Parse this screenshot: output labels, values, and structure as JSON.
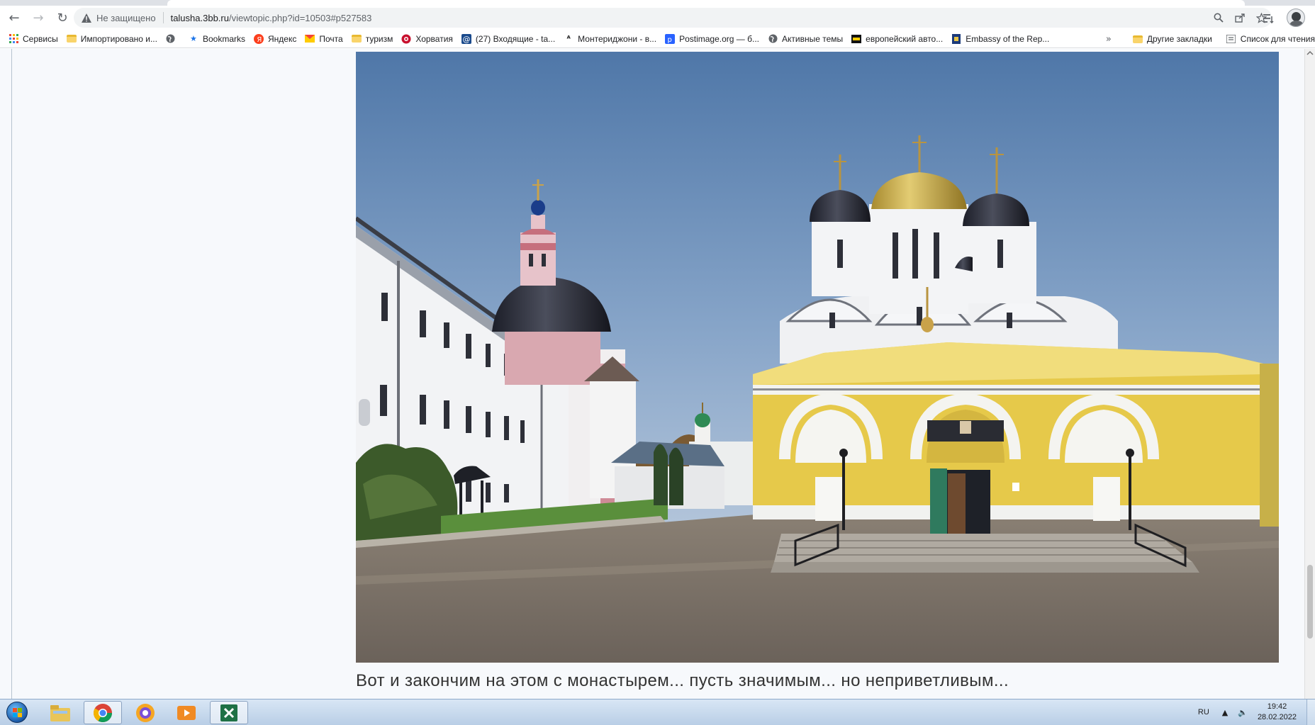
{
  "browser": {
    "security_text": "Не защищено",
    "url_host": "talusha.3bb.ru",
    "url_path": "/viewtopic.php?id=10503#p527583",
    "nav": {
      "back": "←",
      "forward": "→",
      "reload": "↻"
    },
    "omnibox_icons": [
      "zoom-icon",
      "share-icon",
      "star-icon"
    ],
    "toolbar_icons": [
      "reading-list-icon"
    ]
  },
  "bookmarks": {
    "items": [
      {
        "label": "Сервисы",
        "icon": "apps-grid-icon"
      },
      {
        "label": "Импортировано и...",
        "icon": "folder-icon"
      },
      {
        "label": "",
        "icon": "globe-icon"
      },
      {
        "label": "Bookmarks",
        "icon": "star-icon"
      },
      {
        "label": "Яндекс",
        "icon": "yandex-icon"
      },
      {
        "label": "Почта",
        "icon": "mail-icon"
      },
      {
        "label": "туризм",
        "icon": "folder-icon"
      },
      {
        "label": "Хорватия",
        "icon": "croatia-icon"
      },
      {
        "label": "(27) Входящие - ta...",
        "icon": "mail-at-icon"
      },
      {
        "label": "Монтериджони - в...",
        "icon": "tripadvisor-icon"
      },
      {
        "label": "Postimage.org — б...",
        "icon": "postimage-icon"
      },
      {
        "label": "Активные темы",
        "icon": "globe-icon"
      },
      {
        "label": "европейский авто...",
        "icon": "eu-icon"
      },
      {
        "label": "Embassy of the Rep...",
        "icon": "embassy-icon"
      }
    ],
    "more": "»",
    "other_label": "Другие закладки",
    "reading_list_label": "Список для чтения"
  },
  "post": {
    "photo_alt": "Монастырь: белый корпус, розовая церковь и жёлтый собор с куполами",
    "caption": "Вот и закончим на этом с монастырем... пусть значимым... но неприветливым..."
  },
  "taskbar": {
    "apps": [
      "windows-start-icon",
      "explorer-icon",
      "chrome-icon",
      "browser-icon",
      "media-player-icon",
      "excel-icon"
    ],
    "lang": "RU",
    "time": "19:42",
    "date": "28.02.2022"
  }
}
